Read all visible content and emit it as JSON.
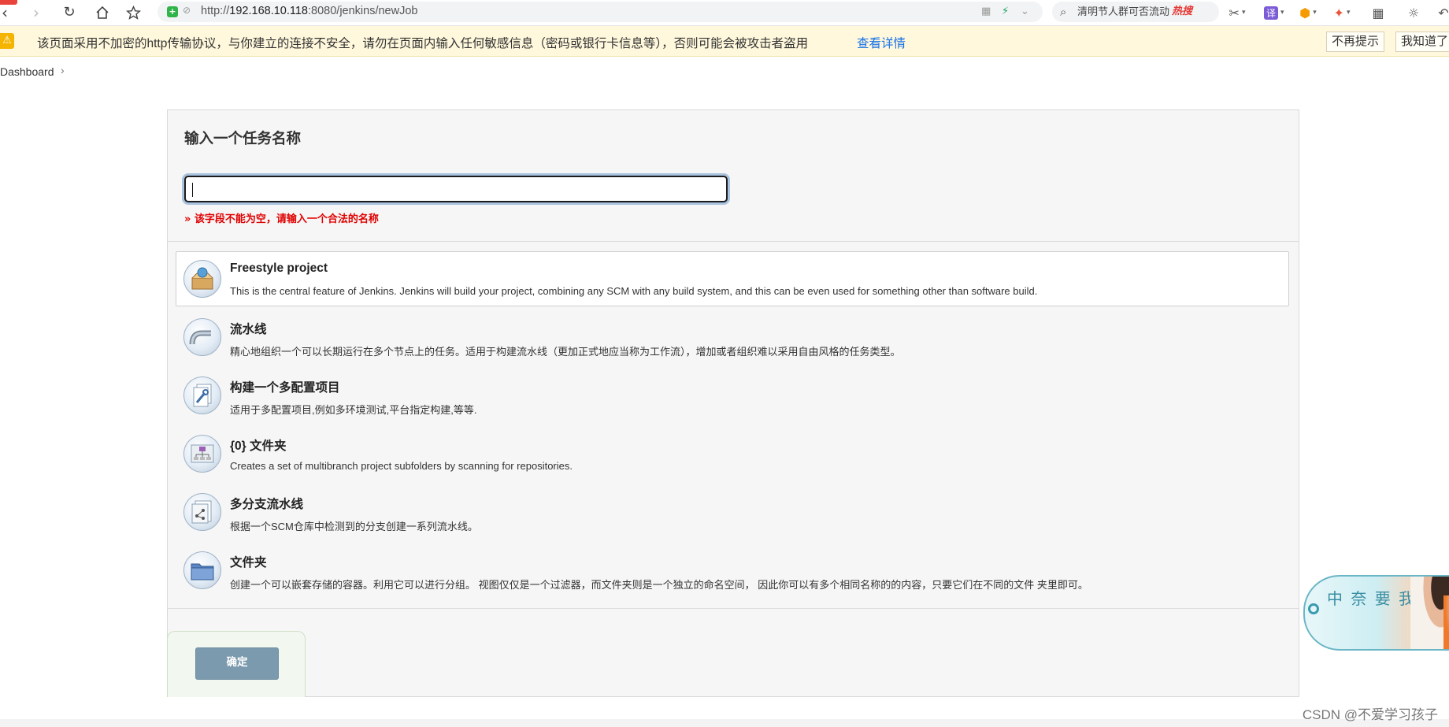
{
  "browser": {
    "url_prefix": "http://",
    "url_host": "192.168.10.118",
    "url_rest": ":8080/jenkins/newJob",
    "search_text": "清明节人群可否流动",
    "search_hot": "热搜",
    "translate_label": "译"
  },
  "warning": {
    "text": "该页面采用不加密的http传输协议，与你建立的连接不安全，请勿在页面内输入任何敏感信息（密码或银行卡信息等），否则可能会被攻击者盗用",
    "link": "查看详情",
    "btn_no_remind": "不再提示",
    "btn_got_it": "我知道了"
  },
  "breadcrumb": {
    "dashboard": "Dashboard"
  },
  "form": {
    "title": "输入一个任务名称",
    "input_value": "",
    "error": "» 该字段不能为空，请输入一个合法的名称"
  },
  "job_types": [
    {
      "name": "Freestyle project",
      "desc": "This is the central feature of Jenkins. Jenkins will build your project, combining any SCM with any build system, and this can be even used for something other than software build.",
      "icon": "freestyle-icon"
    },
    {
      "name": "流水线",
      "desc": "精心地组织一个可以长期运行在多个节点上的任务。适用于构建流水线（更加正式地应当称为工作流），增加或者组织难以采用自由风格的任务类型。",
      "icon": "pipeline-icon"
    },
    {
      "name": "构建一个多配置项目",
      "desc": "适用于多配置项目,例如多环境测试,平台指定构建,等等.",
      "icon": "multi-config-icon"
    },
    {
      "name": "{0} 文件夹",
      "desc": "Creates a set of multibranch project subfolders by scanning for repositories.",
      "icon": "org-folder-icon"
    },
    {
      "name": "多分支流水线",
      "desc": "根据一个SCM仓库中检测到的分支创建一系列流水线。",
      "icon": "multibranch-icon"
    },
    {
      "name": "文件夹",
      "desc": "创建一个可以嵌套存储的容器。利用它可以进行分组。 视图仅仅是一个过滤器，而文件夹则是一个独立的命名空间， 因此你可以有多个相同名称的的内容，只要它们在不同的文件 夹里即可。",
      "icon": "folder-icon"
    }
  ],
  "ok_button": "确定",
  "watermark": "CSDN @不爱学习孩子",
  "ad": {
    "text": "中  奈  要 我"
  },
  "colors": {
    "warning_bg": "#fff8dc",
    "link": "#1a73e8",
    "error": "#e00000",
    "ok_button": "#7b9aad"
  }
}
